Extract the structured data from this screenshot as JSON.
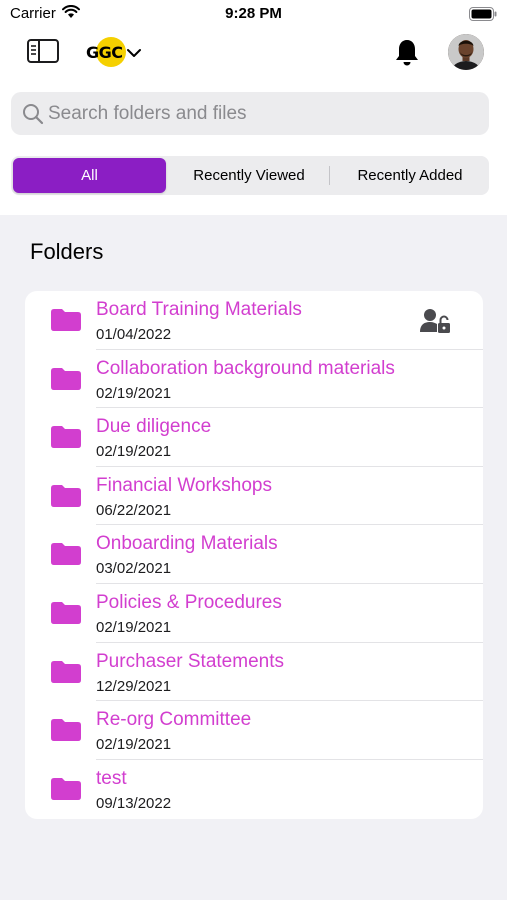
{
  "status_bar": {
    "carrier": "Carrier",
    "time": "9:28 PM"
  },
  "header": {
    "logo_text": "GGC",
    "icons": [
      "sidebar-icon",
      "chevron-down-icon",
      "bell-icon",
      "avatar"
    ]
  },
  "search": {
    "placeholder": "Search folders and files"
  },
  "tabs": [
    {
      "label": "All",
      "selected": true
    },
    {
      "label": "Recently Viewed",
      "selected": false
    },
    {
      "label": "Recently Added",
      "selected": false
    }
  ],
  "section_title": "Folders",
  "folders": [
    {
      "name": "Board Training Materials",
      "date": "01/04/2022",
      "locked": true
    },
    {
      "name": "Collaboration  background materials",
      "date": "02/19/2021"
    },
    {
      "name": "Due diligence",
      "date": "02/19/2021"
    },
    {
      "name": "Financial Workshops",
      "date": "06/22/2021"
    },
    {
      "name": "Onboarding Materials",
      "date": "03/02/2021"
    },
    {
      "name": "Policies & Procedures",
      "date": "02/19/2021"
    },
    {
      "name": "Purchaser Statements",
      "date": "12/29/2021"
    },
    {
      "name": "Re-org Committee",
      "date": "02/19/2021"
    },
    {
      "name": "test",
      "date": "09/13/2022"
    }
  ],
  "colors": {
    "accent": "#8b1ec4",
    "folder": "#d23ecf",
    "logo": "#f5d000"
  }
}
